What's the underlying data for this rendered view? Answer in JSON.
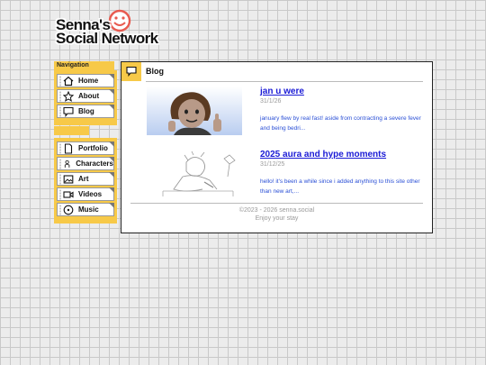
{
  "logo": {
    "line1": "Senna's",
    "line2": "Social Network"
  },
  "sidebar": {
    "title": "Navigation",
    "group1": [
      {
        "label": "Home",
        "icon": "home-icon"
      },
      {
        "label": "About",
        "icon": "star-icon"
      },
      {
        "label": "Blog",
        "icon": "speech-bubble-icon"
      }
    ],
    "group2": [
      {
        "label": "Portfolio",
        "icon": "document-icon"
      },
      {
        "label": "Characters",
        "icon": "person-icon"
      },
      {
        "label": "Art",
        "icon": "picture-icon"
      },
      {
        "label": "Videos",
        "icon": "video-camera-icon"
      },
      {
        "label": "Music",
        "icon": "music-disc-icon"
      }
    ]
  },
  "main": {
    "title": "Blog",
    "posts": [
      {
        "title": "jan u were",
        "date": "31/1/26",
        "excerpt": "january flew by real fast! aside from contracting a severe fever and being bedri..."
      },
      {
        "title": "2025 aura and hype moments",
        "date": "31/12/25",
        "excerpt": "hello! it's been a while since i added anything to this site other than new art,..."
      }
    ],
    "footer": {
      "copyright": "©2023 - 2026 senna.social",
      "tagline": "Enjoy your stay"
    }
  },
  "colors": {
    "accent": "#f7c948",
    "link": "#1a1ad6",
    "excerpt": "#2a4fd6",
    "logo_smile": "#e85a4f"
  }
}
